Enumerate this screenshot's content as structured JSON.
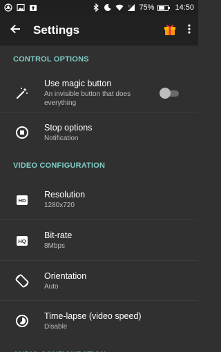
{
  "status_bar": {
    "battery_percent_text": "75%",
    "battery_level": 0.75,
    "time": "14:50",
    "left_icons": [
      "chrome-icon",
      "gallery-icon",
      "upload-icon"
    ],
    "right_icons": [
      "bluetooth-icon",
      "do-not-disturb-icon",
      "wifi-icon",
      "signal-icon",
      "battery-icon"
    ]
  },
  "app_bar": {
    "title": "Settings",
    "back_icon": "arrow-back-icon",
    "gift_icon": "gift-icon",
    "more_icon": "more-vert-icon"
  },
  "sections": [
    {
      "header": "CONTROL OPTIONS",
      "items": [
        {
          "label": "Use magic button",
          "sub": "An invisible button that does everything",
          "icon": "magic-wand-icon",
          "toggle": false
        },
        {
          "label": "Stop options",
          "sub": "Notification",
          "icon": "stop-circle-icon"
        }
      ]
    },
    {
      "header": "VIDEO CONFIGURATION",
      "items": [
        {
          "label": "Resolution",
          "sub": "1280x720",
          "icon": "hd-icon"
        },
        {
          "label": "Bit-rate",
          "sub": "8Mbps",
          "icon": "hq-icon"
        },
        {
          "label": "Orientation",
          "sub": "Auto",
          "icon": "screen-rotation-icon"
        },
        {
          "label": "Time-lapse (video speed)",
          "sub": "Disable",
          "icon": "timelapse-icon"
        }
      ]
    },
    {
      "header": "AUDIO CONFIGURATION",
      "items": []
    }
  ],
  "colors": {
    "background": "#303030",
    "app_bar": "#212121",
    "status_bar": "#1f1f1f",
    "section_header": "#80cbc4",
    "gift_accent": "#ff9800"
  }
}
